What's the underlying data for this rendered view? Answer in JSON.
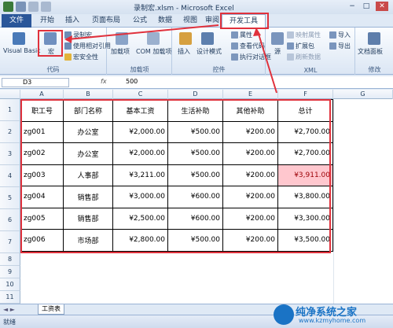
{
  "window": {
    "title": "录制宏.xlsm - Microsoft Excel",
    "min": "−",
    "max": "□",
    "close": "✕"
  },
  "tabs": [
    {
      "label": "文件"
    },
    {
      "label": "开始"
    },
    {
      "label": "插入"
    },
    {
      "label": "页面布局"
    },
    {
      "label": "公式"
    },
    {
      "label": "数据"
    },
    {
      "label": "视图"
    },
    {
      "label": "审阅"
    },
    {
      "label": "开发工具"
    }
  ],
  "ribbon": {
    "code": {
      "label": "代码",
      "visual_basic": "Visual Basic",
      "macros": "宏",
      "record": "录制宏",
      "relative": "使用相对引用",
      "security": "宏安全性"
    },
    "addins": {
      "label": "加载项",
      "addins": "加载项",
      "com_addins": "COM 加载项"
    },
    "controls": {
      "label": "控件",
      "insert": "插入",
      "design_mode": "设计模式",
      "properties": "属性",
      "view_code": "查看代码",
      "run_dialog": "执行对话框"
    },
    "xml": {
      "label": "XML",
      "source": "源",
      "map_props": "映射属性",
      "ext_pack": "扩展包",
      "refresh": "刷新数据",
      "import": "导入",
      "export": "导出"
    },
    "modify": {
      "label": "修改",
      "doc_panel": "文档面板"
    }
  },
  "formula_bar": {
    "name_box": "D3",
    "fx": "fx",
    "value": "500"
  },
  "columns": [
    "A",
    "B",
    "C",
    "D",
    "E",
    "F",
    "G"
  ],
  "rows": [
    "1",
    "2",
    "3",
    "4",
    "5",
    "6",
    "7",
    "8",
    "9",
    "10",
    "11"
  ],
  "table": {
    "header": [
      "职工号",
      "部门名称",
      "基本工资",
      "生活补助",
      "其他补助",
      "总计"
    ],
    "rows": [
      [
        "zg001",
        "办公室",
        "¥2,000.00",
        "¥500.00",
        "¥200.00",
        "¥2,700.00"
      ],
      [
        "zg002",
        "办公室",
        "¥2,000.00",
        "¥500.00",
        "¥200.00",
        "¥2,700.00"
      ],
      [
        "zg003",
        "人事部",
        "¥3,211.00",
        "¥500.00",
        "¥200.00",
        "¥3,911.00"
      ],
      [
        "zg004",
        "销售部",
        "¥3,000.00",
        "¥600.00",
        "¥200.00",
        "¥3,800.00"
      ],
      [
        "zg005",
        "销售部",
        "¥2,500.00",
        "¥600.00",
        "¥200.00",
        "¥3,300.00"
      ],
      [
        "zg006",
        "市场部",
        "¥2,800.00",
        "¥500.00",
        "¥200.00",
        "¥3,500.00"
      ]
    ]
  },
  "sheet": {
    "tab": "工资表"
  },
  "status": {
    "text": "就绪"
  },
  "watermark": {
    "title": "纯净系统之家",
    "url": "www.kzmyhome.com"
  },
  "colors": {
    "accent_red": "#e0313c",
    "highlight": "#ffc7ce",
    "file_tab": "#2a5699"
  }
}
